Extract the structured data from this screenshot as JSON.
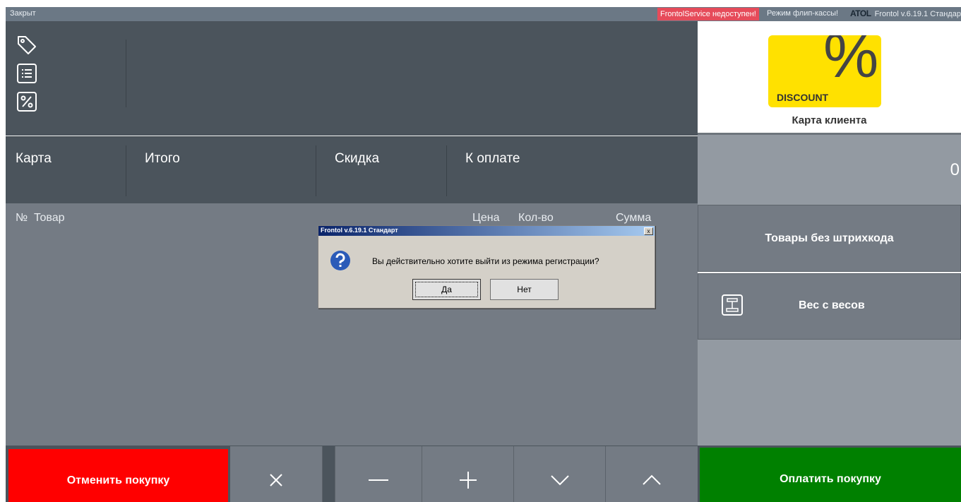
{
  "topbar": {
    "status": "Закрыт",
    "service_error": "FrontolService недоступен!",
    "flip_mode": "Режим флип-кассы!",
    "brand_logo": "ATOL",
    "version": "Frontol v.6.19.1 Стандар"
  },
  "tools": {
    "icons": [
      "tag-icon",
      "list-icon",
      "percent-icon"
    ]
  },
  "totals": {
    "card": "Карта",
    "total": "Итого",
    "discount": "Скидка",
    "to_pay": "К оплате"
  },
  "items": {
    "columns": {
      "num": "№",
      "product": "Товар",
      "price": "Цена",
      "qty": "Кол-во",
      "sum": "Сумма"
    }
  },
  "card": {
    "discount_text": "DISCOUNT",
    "percent_glyph": "%",
    "label": "Карта клиента"
  },
  "sum_display": "0",
  "side_buttons": {
    "no_barcode": "Товары без штрихкода",
    "weight": "Вес с весов"
  },
  "bottom": {
    "cancel": "Отменить покупку",
    "pay": "Оплатить покупку",
    "icons": [
      "close-icon",
      "minus-icon",
      "plus-icon",
      "chevron-down-icon",
      "chevron-up-icon"
    ]
  },
  "dialog": {
    "title": "Frontol v.6.19.1 Стандарт",
    "close": "x",
    "message": "Вы действительно хотите выйти из режима регистрации?",
    "yes": "Да",
    "no": "Нет"
  },
  "colors": {
    "cancel": "#ff0000",
    "pay": "#008000",
    "card_yellow": "#ffe100",
    "error_badge": "#e64b5a"
  }
}
